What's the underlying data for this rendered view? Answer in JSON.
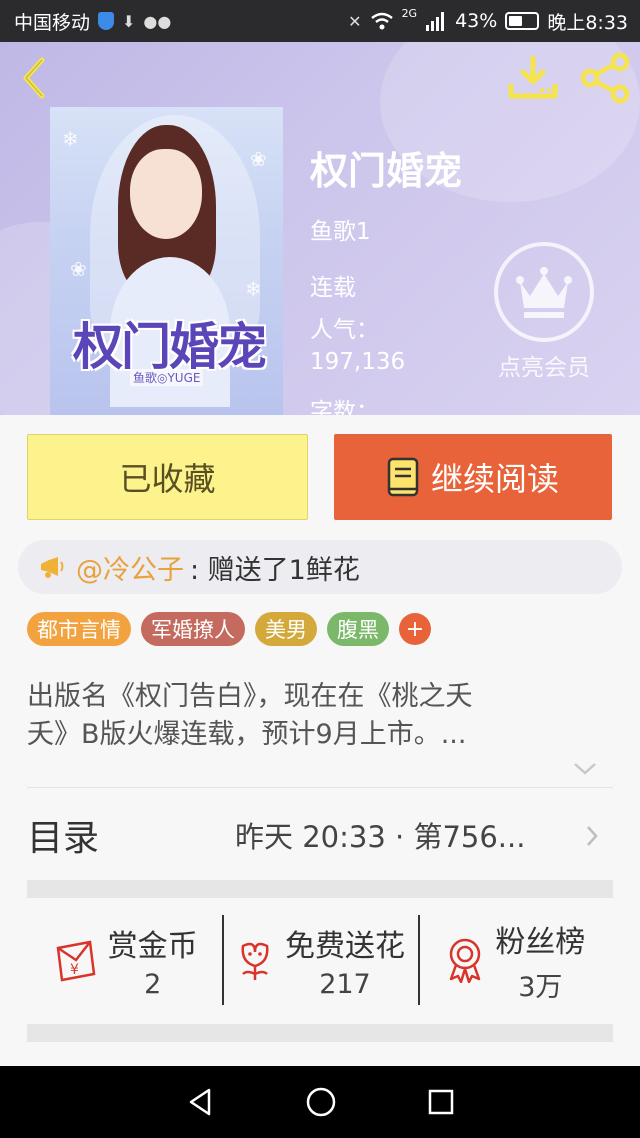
{
  "status_bar": {
    "carrier": "中国移动",
    "network": "2G",
    "battery": "43%",
    "time": "晚上8:33"
  },
  "book": {
    "title": "权门婚宠",
    "author": "鱼歌1",
    "status": "连载",
    "popularity_label": "人气：",
    "popularity_value": "197,136",
    "words_label": "字数："
  },
  "cover": {
    "title": "权门婚宠",
    "author": "鱼歌◎YUGE"
  },
  "vip": {
    "label": "点亮会员"
  },
  "actions": {
    "favorite_label": "已收藏",
    "read_label": "继续阅读"
  },
  "gift": {
    "user": "@冷公子",
    "message": ": 赠送了1鲜花"
  },
  "tags": [
    {
      "label": "都市言情",
      "color": "#f2a340"
    },
    {
      "label": "军婚撩人",
      "color": "#c46a5e"
    },
    {
      "label": "美男",
      "color": "#d4a93c"
    },
    {
      "label": "腹黑",
      "color": "#7bb86a"
    }
  ],
  "tag_more": "+",
  "description": {
    "line1": "出版名《权门告白》，现在在《桃之夭",
    "line2": "夭》B版火爆连载，预计9月上市。..."
  },
  "catalog": {
    "label": "目录",
    "latest": "昨天 20:33 · 第756..."
  },
  "stats": [
    {
      "name": "赏金币",
      "value": "2",
      "icon": "red-envelope-icon"
    },
    {
      "name": "免费送花",
      "value": "217",
      "icon": "flower-icon"
    },
    {
      "name": "粉丝榜",
      "value": "3万",
      "icon": "medal-icon"
    }
  ],
  "colors": {
    "accent_orange": "#e8633a",
    "favorite_yellow": "#fdf38c",
    "gift_user": "#e8a23d",
    "icon_red": "#d9342b"
  }
}
